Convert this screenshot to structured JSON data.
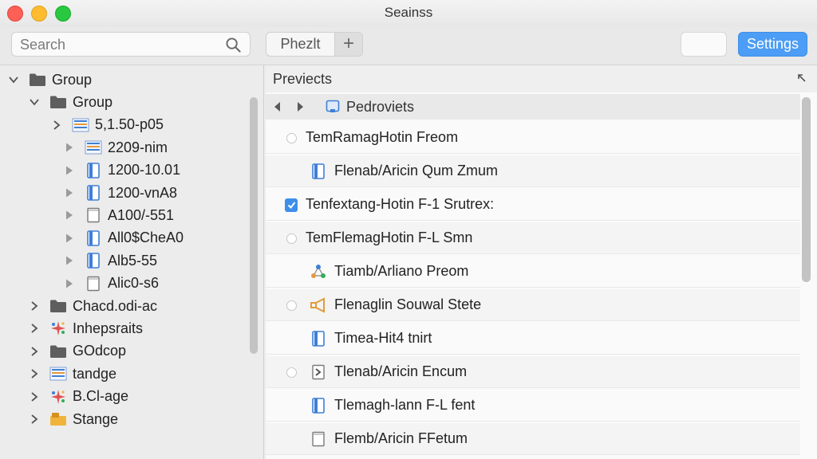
{
  "window": {
    "title": "Seainss"
  },
  "toolbar": {
    "search_placeholder": "Search",
    "segment_label": "Phezlt",
    "add_label": "+",
    "settings_label": "Settings"
  },
  "sidebar": {
    "items": [
      {
        "label": "Group",
        "icon": "folder-icon",
        "level": 0,
        "expanded": true
      },
      {
        "label": "Group",
        "icon": "folder-icon",
        "level": 1,
        "expanded": true
      },
      {
        "label": "5,1.50-p05",
        "icon": "list-doc-icon",
        "level": 2,
        "expanded": false
      },
      {
        "label": "2209-nim",
        "icon": "list-doc-icon",
        "level": 3,
        "expanded": false
      },
      {
        "label": "1200-10.01",
        "icon": "document-icon",
        "level": 3,
        "expanded": false
      },
      {
        "label": "1200-vnA8",
        "icon": "document-icon",
        "level": 3,
        "expanded": false
      },
      {
        "label": "A100/-551",
        "icon": "blank-doc-icon",
        "level": 3,
        "expanded": false
      },
      {
        "label": "All0$CheA0",
        "icon": "document-icon",
        "level": 3,
        "expanded": false
      },
      {
        "label": "Alb5-55",
        "icon": "document-icon",
        "level": 3,
        "expanded": false
      },
      {
        "label": "Alic0-s6",
        "icon": "blank-doc-icon",
        "level": 3,
        "expanded": false
      },
      {
        "label": "Chacd.odi-ac",
        "icon": "folder-icon",
        "level": 1,
        "expanded": false
      },
      {
        "label": "Inhepsraits",
        "icon": "sparkle-icon",
        "level": 1,
        "expanded": false
      },
      {
        "label": "GOdcop",
        "icon": "folder-icon",
        "level": 1,
        "expanded": false
      },
      {
        "label": "tandge",
        "icon": "list-doc-icon",
        "level": 1,
        "expanded": false
      },
      {
        "label": "B.Cl-age",
        "icon": "sparkle-icon",
        "level": 1,
        "expanded": false
      },
      {
        "label": "Stange",
        "icon": "box-icon",
        "level": 1,
        "expanded": false
      }
    ]
  },
  "main": {
    "title": "Previects",
    "breadcrumb": "Pedroviets",
    "rows": [
      {
        "label": "TemRamagHotin Freom",
        "mark": "radio",
        "icon": "",
        "indent": 0
      },
      {
        "label": "Flenab/Aricin Qum Zmum",
        "mark": "",
        "icon": "document-icon",
        "indent": 1
      },
      {
        "label": "Tenfextang-Hotin F-1 Srutrex:",
        "mark": "checkbox",
        "icon": "",
        "indent": 0
      },
      {
        "label": "TemFlemagHotin F-L Smn",
        "mark": "radio",
        "icon": "",
        "indent": 0
      },
      {
        "label": "Tiamb/Arliano Preom",
        "mark": "",
        "icon": "network-icon",
        "indent": 1
      },
      {
        "label": "Flenaglin Souwal Stete",
        "mark": "radio",
        "icon": "megaphone-icon",
        "indent": 0
      },
      {
        "label": "Timea-Hit4 tnirt",
        "mark": "",
        "icon": "document-icon",
        "indent": 1
      },
      {
        "label": "Tlenab/Aricin Encum",
        "mark": "radio",
        "icon": "tag-icon",
        "indent": 0
      },
      {
        "label": "Tlemagh-lann F-L fent",
        "mark": "",
        "icon": "document-icon",
        "indent": 1
      },
      {
        "label": "Flemb/Aricin FFetum",
        "mark": "",
        "icon": "blank-doc-icon",
        "indent": 1
      }
    ]
  },
  "colors": {
    "accent": "#4c9df5",
    "folder": "#5b5b5b",
    "doc_blue": "#3f7fd6",
    "traffic_close": "#fe5f57",
    "traffic_min": "#febc2e",
    "traffic_max": "#28c840"
  }
}
